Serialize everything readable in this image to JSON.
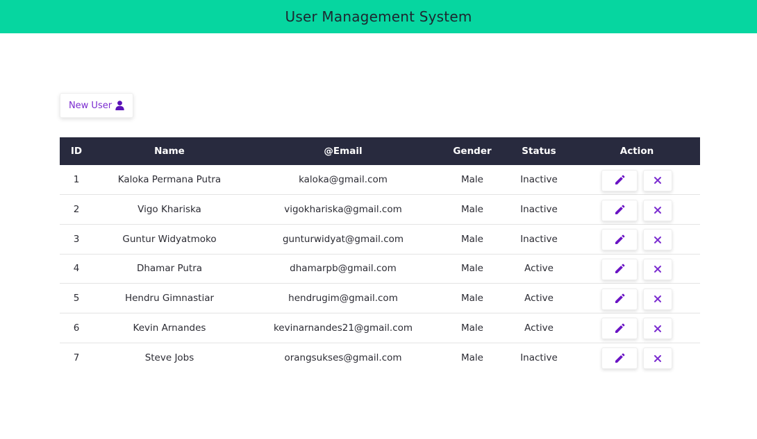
{
  "header": {
    "title": "User Management System"
  },
  "toolbar": {
    "new_user_label": "New User",
    "new_user_icon": "user-icon"
  },
  "colors": {
    "accent": "#06d6a0",
    "table_header": "#282a3e",
    "action": "#7b2cd0"
  },
  "table": {
    "columns": [
      "ID",
      "Name",
      "@Email",
      "Gender",
      "Status",
      "Action"
    ],
    "rows": [
      {
        "id": "1",
        "name": "Kaloka Permana Putra",
        "email": "kaloka@gmail.com",
        "gender": "Male",
        "status": "Inactive"
      },
      {
        "id": "2",
        "name": "Vigo Khariska",
        "email": "vigokhariska@gmail.com",
        "gender": "Male",
        "status": "Inactive"
      },
      {
        "id": "3",
        "name": "Guntur Widyatmoko",
        "email": "gunturwidyat@gmail.com",
        "gender": "Male",
        "status": "Inactive"
      },
      {
        "id": "4",
        "name": "Dhamar Putra",
        "email": "dhamarpb@gmail.com",
        "gender": "Male",
        "status": "Active"
      },
      {
        "id": "5",
        "name": "Hendru Gimnastiar",
        "email": "hendrugim@gmail.com",
        "gender": "Male",
        "status": "Active"
      },
      {
        "id": "6",
        "name": "Kevin Arnandes",
        "email": "kevinarnandes21@gmail.com",
        "gender": "Male",
        "status": "Active"
      },
      {
        "id": "7",
        "name": "Steve Jobs",
        "email": "orangsukses@gmail.com",
        "gender": "Male",
        "status": "Inactive"
      }
    ],
    "row_actions": {
      "edit_icon": "pencil-icon",
      "delete_icon": "close-icon"
    }
  }
}
